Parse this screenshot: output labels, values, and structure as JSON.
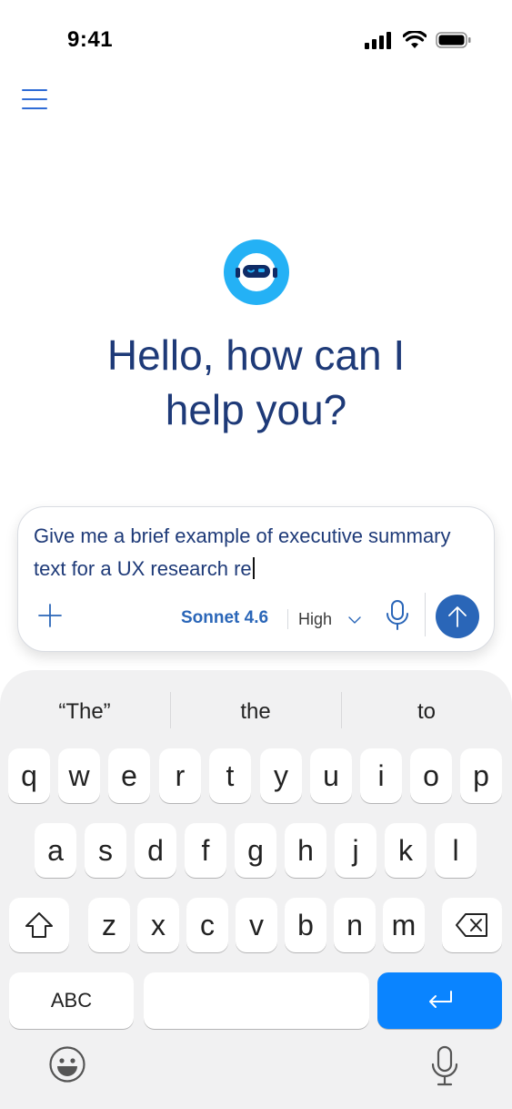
{
  "status_bar": {
    "time": "9:41"
  },
  "greeting": {
    "line1": "Hello, how can I",
    "line2": "help you?"
  },
  "prompt": {
    "text": "Give me a brief example of executive summary text for a UX research re",
    "model": "Sonnet 4.6",
    "effort": "High"
  },
  "keyboard": {
    "suggestions": [
      "“The”",
      "the",
      "to"
    ],
    "row1": [
      "q",
      "w",
      "e",
      "r",
      "t",
      "y",
      "u",
      "i",
      "o",
      "p"
    ],
    "row2": [
      "a",
      "s",
      "d",
      "f",
      "g",
      "h",
      "j",
      "k",
      "l"
    ],
    "row3": [
      "z",
      "x",
      "c",
      "v",
      "b",
      "n",
      "m"
    ],
    "abc_label": "ABC"
  },
  "colors": {
    "accent": "#2a66b8",
    "greeting_text": "#1e3a78",
    "avatar_bg": "#24b1f5",
    "return_key": "#0a84ff",
    "keyboard_bg": "#f1f1f2"
  },
  "icons": {
    "menu": "hamburger-icon",
    "avatar": "robot-icon",
    "plus": "plus-icon",
    "chevron": "chevron-down-icon",
    "mic": "microphone-icon",
    "send": "arrow-up-icon",
    "shift": "shift-icon",
    "delete": "backspace-icon",
    "return": "return-icon",
    "emoji": "emoji-icon",
    "dictation": "microphone-icon"
  }
}
